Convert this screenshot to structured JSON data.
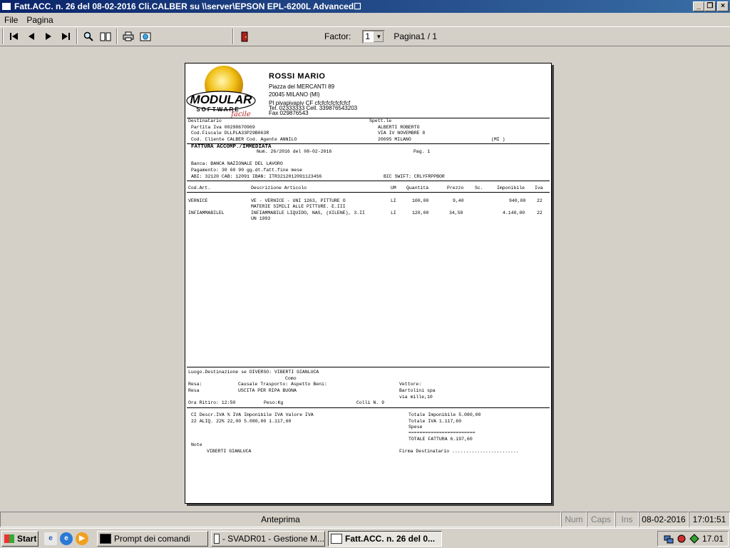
{
  "window": {
    "title": "Fatt.ACC. n.   26 del 08-02-2016 Cli.CALBER su \\\\server\\EPSON EPL-6200L Advanced☐",
    "minimize": "_",
    "maximize": "ő",
    "close": "×"
  },
  "menu": {
    "file": "File",
    "pagina": "Pagina"
  },
  "toolbar": {
    "factor_label": "Factor:",
    "factor_value": "1",
    "page_label": "Pagina1 / 1"
  },
  "invoice": {
    "company": {
      "name": "ROSSI MARIO",
      "address": "Piazza del MERCANTI 89",
      "city": "20045 MILANO (MI)",
      "piva": "PI pivapivapiv   CF cfcfcfcfcfcfcfcf",
      "tel": "Tel. 02333333   Cell. 339876543203",
      "fax": "Fax 029876543"
    },
    "logo_text": "MODULAR",
    "logo_sub": "SOFTWARE",
    "logo_script": "facile",
    "destinatario_label": "Destinatario",
    "spett_label": "Spett.le",
    "partita_iva": "Partita Iva    00298670969",
    "cod_fiscale": "Cod.Fiscale    DLLPLA33P29B063R",
    "cod_cliente": "Cod. Cliente   CALBER     Cod. Agente ANNILO",
    "cliente_nome": "ALBERTI ROBERTO",
    "cliente_via": "VIA IV NOVEMBRE 8",
    "cliente_cap": "20095      MILANO",
    "cliente_prov": "(MI )",
    "doc_type": "FATTURA ACCOMP./IMMEDIATA",
    "doc_num": "Num.     26/2016  del 08-02-2016",
    "doc_pag": "Pag.   1",
    "banca": "Banca: BANCA NAZIONALE DEL LAVORO",
    "pagamento": "Pagamento: 30 60 90 gg.dt.fatt.fine mese",
    "abi": "ABI: 32120  CAB: 12091  IBAN: ITR32120120911234S6",
    "bic": "BIC SWIFT: CRLYFRPPBOR",
    "headers": {
      "cod": "Cod.Art.",
      "desc": "Descrizione Articolo",
      "um": "UM",
      "qta": "Quantità",
      "prezzo": "Prezzo",
      "sc": "Sc.",
      "imponibile": "Imponibile",
      "iva": "Iva"
    },
    "rows": [
      {
        "cod": "VERNICE",
        "desc1": "VE - VERNICE    -   UNI 1263, PITTURE O",
        "desc2": "MATERIE SIMILI ALLE PITTURE. E.III",
        "um": "LI",
        "qta": "100,00",
        "prezzo": "9,40",
        "imponibile": "940,00",
        "iva": "22"
      },
      {
        "cod": "INFIAMMABILEL",
        "desc1": "INFIAMMABILE LIQUIDO, NAS, (XILENE), 3.II",
        "desc2": "UN 1993",
        "um": "LI",
        "qta": "120,00",
        "prezzo": "34,50",
        "imponibile": "4.140,00",
        "iva": "22"
      }
    ],
    "luogo": "Luogo.Destinazione se DIVERSO: VIBERTI GIANLUCA",
    "luogo_city": "Como",
    "resa_label": "Resa:",
    "causale_label": "Causale Trasporto: Aspetto Beni:",
    "vettore_label": "Vettore:",
    "resa_value": "Resa",
    "causale_value": "USCITA PER RIPA    BUONA",
    "vettore_name": "Bartolini spa",
    "vettore_addr": "via mille,10",
    "ora_ritiro": "Ora Ritiro: 12:50",
    "peso": "Peso:Kg",
    "colli": "Colli N.    9",
    "iva_header": "CI  Descr.IVA      % IVA  Imponibile IVA    Valore IVA",
    "iva_row": "22  ALIQ. 22%      22,00        5.080,00       1.117,60",
    "tot_imponibile": "Totale Imponibile       5.080,00",
    "tot_iva": "Totale IVA              1.117,60",
    "spese": "Spese",
    "separator": "========================",
    "tot_fattura": "TOTALE FATTURA          6.197,60",
    "note_label": "Note",
    "note_value": "VIBERTI GIANLUCA",
    "firma": "Firma Destinatario ........................"
  },
  "statusbar": {
    "mode": "Anteprima",
    "num": "Num",
    "caps": "Caps",
    "ins": "Ins",
    "date": "08-02-2016",
    "time": "17:01:51"
  },
  "taskbar": {
    "start": "Start",
    "tasks": [
      "Prompt dei comandi",
      "- SVADR01 - Gestione M...",
      "Fatt.ACC. n.  26 del 0..."
    ],
    "clock": "17.01"
  }
}
